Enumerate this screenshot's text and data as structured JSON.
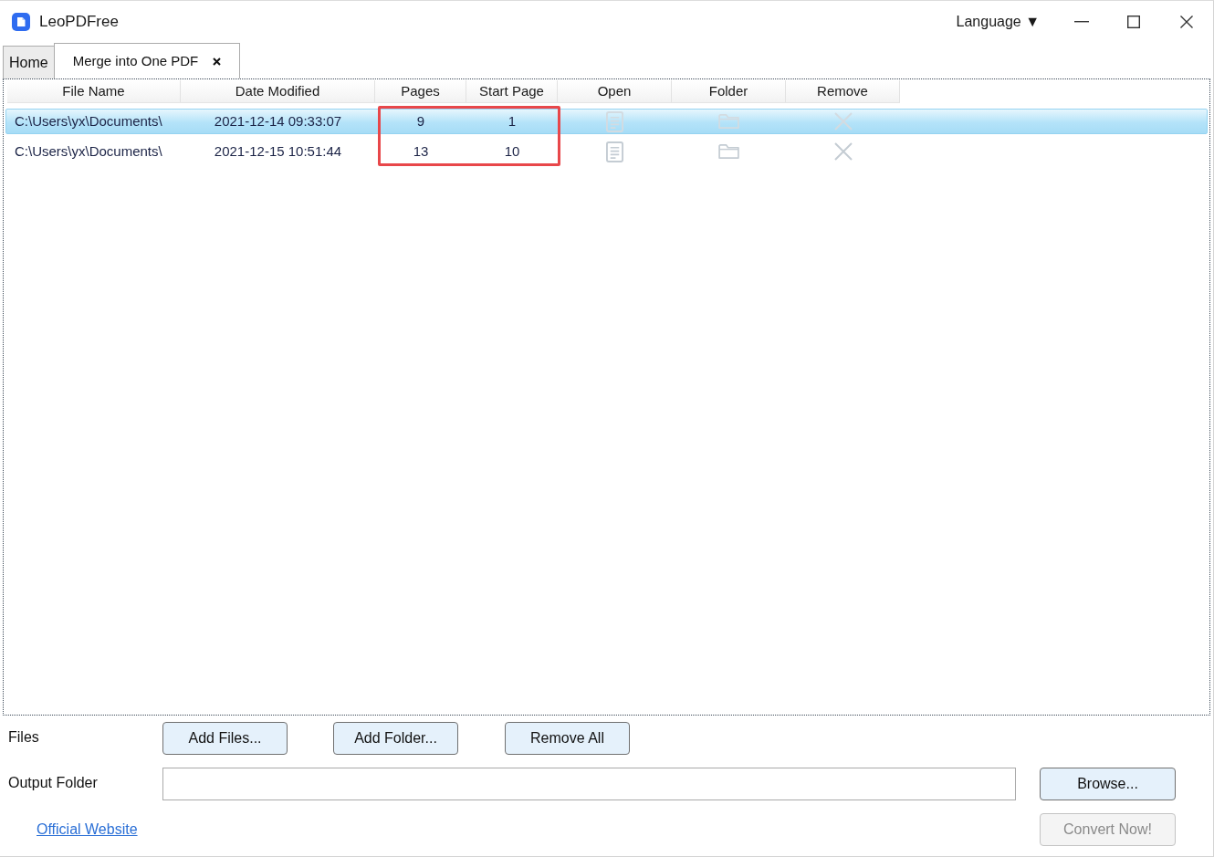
{
  "window": {
    "title": "LeoPDFree",
    "language_menu": "Language ▼"
  },
  "tabs": [
    {
      "label": "Home",
      "selected": false,
      "closable": false
    },
    {
      "label": "Merge into One PDF",
      "selected": true,
      "closable": true
    }
  ],
  "table": {
    "columns": [
      "File Name",
      "Date Modified",
      "Pages",
      "Start Page",
      "Open",
      "Folder",
      "Remove"
    ],
    "page_columns_outlined": true,
    "rows": [
      {
        "file_name": "C:\\Users\\yx\\Documents\\",
        "date_modified": "2021-12-14 09:33:07",
        "pages": "9",
        "start_page": "1",
        "selected": true
      },
      {
        "file_name": "C:\\Users\\yx\\Documents\\",
        "date_modified": "2021-12-15 10:51:44",
        "pages": "13",
        "start_page": "10",
        "selected": false
      }
    ]
  },
  "files_section": {
    "label": "Files",
    "buttons": [
      "Add Files...",
      "Add Folder...",
      "Remove All"
    ]
  },
  "output_section": {
    "label": "Output Folder",
    "browse_button": "Browse..."
  },
  "footer": {
    "link": "Official Website",
    "convert_button": {
      "label": "Convert Now!",
      "disabled": true
    }
  }
}
